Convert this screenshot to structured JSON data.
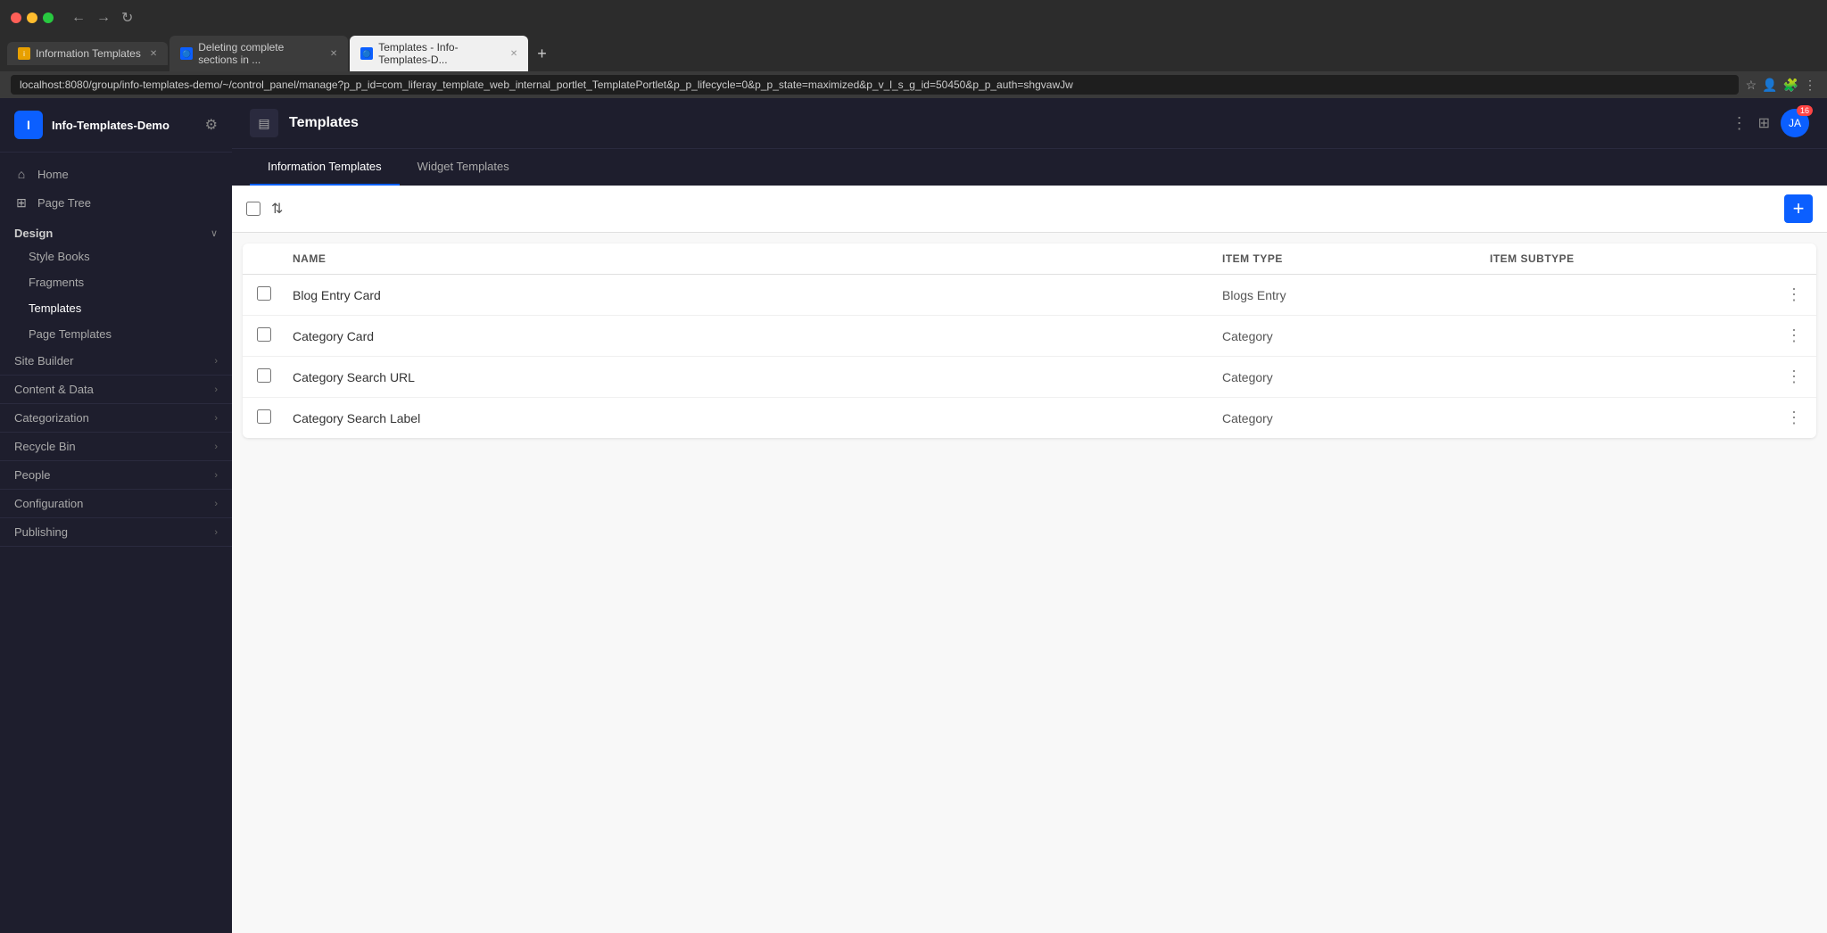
{
  "browser": {
    "tabs": [
      {
        "id": "tab1",
        "favicon_color": "#e8a000",
        "label": "Information Templates",
        "active": false
      },
      {
        "id": "tab2",
        "favicon_color": "#0b5fff",
        "label": "Deleting complete sections in ...",
        "active": false
      },
      {
        "id": "tab3",
        "favicon_color": "#0b5fff",
        "label": "Templates - Info-Templates-D...",
        "active": true
      }
    ],
    "new_tab_label": "+",
    "address": "localhost:8080/group/info-templates-demo/~/control_panel/manage?p_p_id=com_liferay_template_web_internal_portlet_TemplatePortlet&p_p_lifecycle=0&p_p_state=maximized&p_v_l_s_g_id=50450&p_p_auth=shgvawJw",
    "nav": {
      "back": "←",
      "forward": "→",
      "refresh": "↻"
    }
  },
  "sidebar": {
    "logo_letter": "I",
    "site_name": "Info-Templates-Demo",
    "settings_icon": "⚙",
    "nav_items": [
      {
        "id": "home",
        "icon": "⌂",
        "label": "Home"
      },
      {
        "id": "page-tree",
        "icon": "⊞",
        "label": "Page Tree"
      }
    ],
    "design_section": {
      "label": "Design",
      "items": [
        {
          "id": "style-books",
          "label": "Style Books"
        },
        {
          "id": "fragments",
          "label": "Fragments"
        },
        {
          "id": "templates",
          "label": "Templates",
          "active": true
        },
        {
          "id": "page-templates",
          "label": "Page Templates"
        }
      ]
    },
    "expandable_items": [
      {
        "id": "site-builder",
        "label": "Site Builder"
      },
      {
        "id": "content-data",
        "label": "Content & Data"
      },
      {
        "id": "categorization",
        "label": "Categorization"
      },
      {
        "id": "recycle-bin",
        "label": "Recycle Bin"
      },
      {
        "id": "people",
        "label": "People"
      },
      {
        "id": "configuration",
        "label": "Configuration"
      },
      {
        "id": "publishing",
        "label": "Publishing"
      }
    ]
  },
  "portlet": {
    "icon": "▤",
    "title": "Templates",
    "dots_label": "⋮",
    "grid_icon": "⋮⋮",
    "avatar_initials": "JA",
    "avatar_badge": "16"
  },
  "tabs": [
    {
      "id": "information-templates",
      "label": "Information Templates",
      "active": true
    },
    {
      "id": "widget-templates",
      "label": "Widget Templates",
      "active": false
    }
  ],
  "toolbar": {
    "sort_icon": "⇅",
    "add_label": "+"
  },
  "table": {
    "columns": [
      {
        "id": "name",
        "label": "Name"
      },
      {
        "id": "item-type",
        "label": "Item Type"
      },
      {
        "id": "item-subtype",
        "label": "Item Subtype"
      }
    ],
    "rows": [
      {
        "id": "row1",
        "name": "Blog Entry Card",
        "item_type": "Blogs Entry",
        "item_subtype": ""
      },
      {
        "id": "row2",
        "name": "Category Card",
        "item_type": "Category",
        "item_subtype": ""
      },
      {
        "id": "row3",
        "name": "Category Search URL",
        "item_type": "Category",
        "item_subtype": ""
      },
      {
        "id": "row4",
        "name": "Category Search Label",
        "item_type": "Category",
        "item_subtype": ""
      }
    ],
    "actions_icon": "⋮"
  }
}
